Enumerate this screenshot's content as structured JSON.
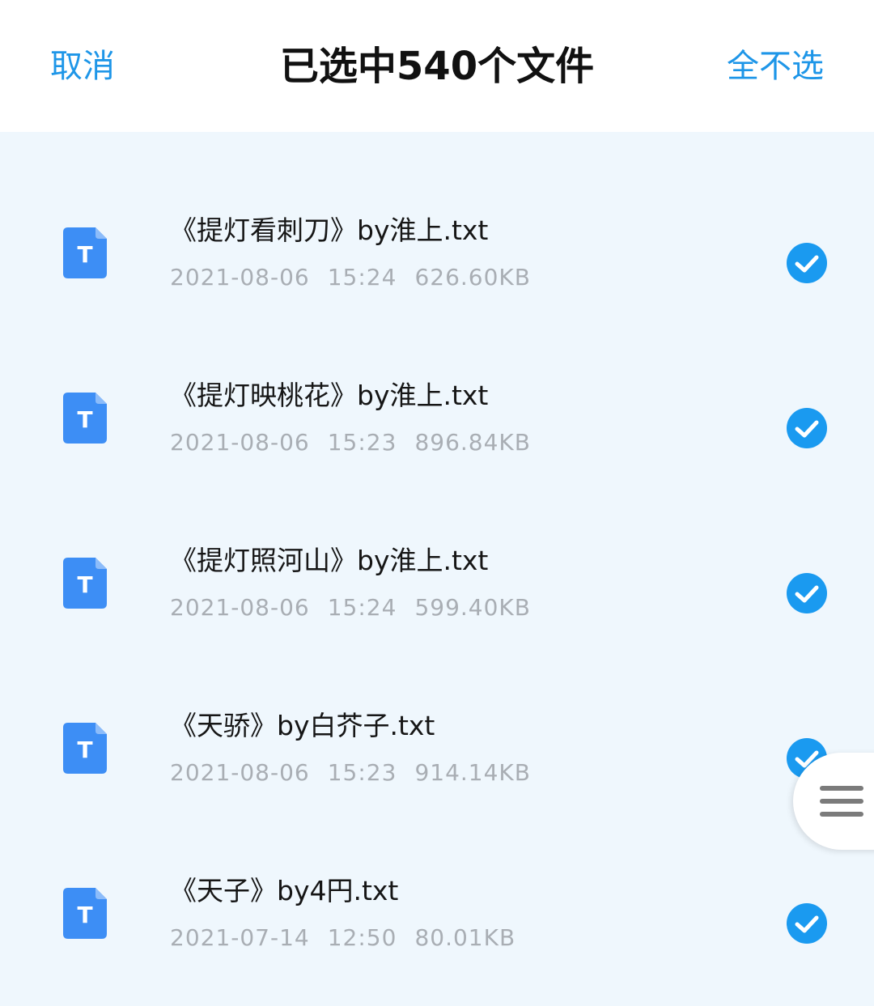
{
  "header": {
    "cancel_label": "取消",
    "title": "已选中540个文件",
    "select_none_label": "全不选"
  },
  "colors": {
    "accent": "#1e96e8",
    "file_icon": "#3d8ef5",
    "check": "#1a9af0",
    "background": "#eff7fd"
  },
  "files": [
    {
      "name": "《提灯看刺刀》by淮上.txt",
      "date": "2021-08-06",
      "time": "15:24",
      "size": "626.60KB",
      "icon": "text-file-icon",
      "icon_letter": "T",
      "selected": true
    },
    {
      "name": "《提灯映桃花》by淮上.txt",
      "date": "2021-08-06",
      "time": "15:23",
      "size": "896.84KB",
      "icon": "text-file-icon",
      "icon_letter": "T",
      "selected": true
    },
    {
      "name": "《提灯照河山》by淮上.txt",
      "date": "2021-08-06",
      "time": "15:24",
      "size": "599.40KB",
      "icon": "text-file-icon",
      "icon_letter": "T",
      "selected": true
    },
    {
      "name": "《天骄》by白芥子.txt",
      "date": "2021-08-06",
      "time": "15:23",
      "size": "914.14KB",
      "icon": "text-file-icon",
      "icon_letter": "T",
      "selected": true
    },
    {
      "name": "《天子》by4円.txt",
      "date": "2021-07-14",
      "time": "12:50",
      "size": "80.01KB",
      "icon": "text-file-icon",
      "icon_letter": "T",
      "selected": true
    }
  ],
  "floating": {
    "icon": "menu-icon"
  }
}
